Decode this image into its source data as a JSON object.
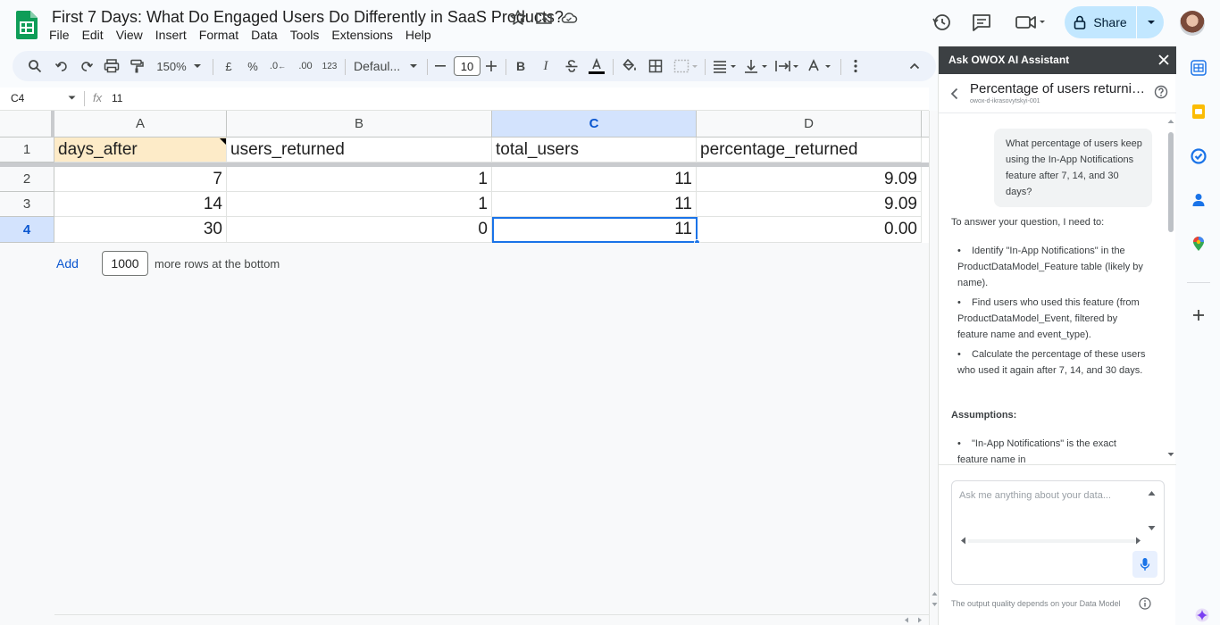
{
  "app": {
    "doc_title": "First 7 Days: What Do Engaged Users Do Differently in SaaS Products?",
    "menu": [
      "File",
      "Edit",
      "View",
      "Insert",
      "Format",
      "Data",
      "Tools",
      "Extensions",
      "Help"
    ],
    "share_label": "Share"
  },
  "toolbar": {
    "zoom": "150%",
    "currency": "£",
    "percent": "%",
    "decrease_decimals": ".0",
    "increase_decimals": ".00",
    "number_format": "123",
    "font": "Defaul...",
    "font_size": "10",
    "bold": "B",
    "italic": "I"
  },
  "formula_bar": {
    "cell_ref": "C4",
    "fx": "fx",
    "value": "11"
  },
  "sheet": {
    "columns": [
      "A",
      "B",
      "C",
      "D"
    ],
    "selected_column": "C",
    "rows": [
      "1",
      "2",
      "3",
      "4"
    ],
    "selected_row": "4",
    "header": [
      "days_after",
      "users_returned",
      "total_users",
      "percentage_returned"
    ],
    "data": [
      [
        "7",
        "1",
        "11",
        "9.09"
      ],
      [
        "14",
        "1",
        "11",
        "9.09"
      ],
      [
        "30",
        "0",
        "11",
        "0.00"
      ]
    ],
    "add_label": "Add",
    "add_rows_value": "1000",
    "add_rows_suffix": "more rows at the bottom"
  },
  "assistant": {
    "panel_title": "Ask OWOX AI Assistant",
    "conversation_title": "Percentage of users returnin...",
    "conversation_sub": "owox-d-ikrasovytskyi-001",
    "user_message": "What percentage of users keep using the In-App Notifications feature after 7, 14, and 30 days?",
    "intro": "To answer your question, I need to:",
    "steps": [
      "Identify \"In-App Notifications\" in the ProductDataModel_Feature table (likely by name).",
      "Find users who used this feature (from ProductDataModel_Event, filtered by feature name and event_type).",
      "Calculate the percentage of these users who used it again after 7, 14, and 30 days."
    ],
    "assumptions_label": "Assumptions:",
    "assumptions": [
      "\"In-App Notifications\" is the exact feature name in"
    ],
    "input_placeholder": "Ask me anything about your data...",
    "footer_note": "The output quality depends on your Data Model"
  },
  "colors": {
    "sheets_green": "#0f9d58",
    "accent_blue": "#0b57d0",
    "share_bg": "#c2e7ff",
    "panel_header": "#3c4043",
    "a1_highlight": "#fdebc8"
  }
}
